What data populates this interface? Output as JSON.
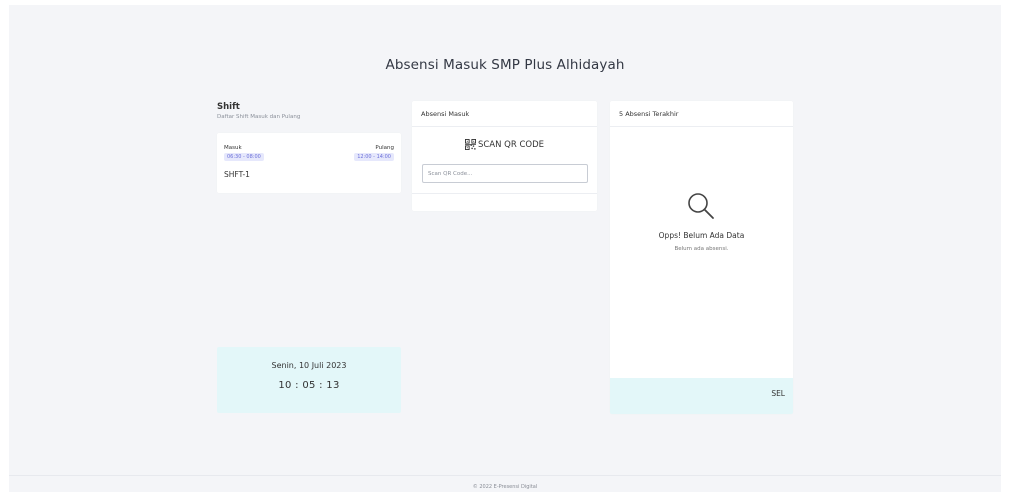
{
  "page": {
    "title": "Absensi Masuk SMP Plus Alhidayah"
  },
  "shift": {
    "title": "Shift",
    "subtitle": "Daftar Shift Masuk dan Pulang",
    "masuk_label": "Masuk",
    "masuk_time": "06:30 - 08:00",
    "pulang_label": "Pulang",
    "pulang_time": "12:00 - 14:00",
    "code": "SHFT-1"
  },
  "absen": {
    "header": "Absensi Masuk",
    "scan_title": "SCAN QR CODE",
    "scan_placeholder": "Scan QR Code..."
  },
  "last": {
    "header": "5 Absensi Terakhir",
    "empty_title": "Opps! Belum Ada Data",
    "empty_sub": "Belum ada absensi.",
    "sel_label": "SEL"
  },
  "clock": {
    "date": "Senin, 10 Juli 2023",
    "time": "10 : 05 : 13"
  },
  "footer": {
    "text": "© 2022 E-Presensi Digital"
  },
  "icons": {
    "qr": "qr-code-icon",
    "search": "search-icon"
  },
  "colors": {
    "badge_bg": "#e6e8fc",
    "badge_text": "#6b6fd8",
    "highlight_bg": "#e3f7f9"
  }
}
